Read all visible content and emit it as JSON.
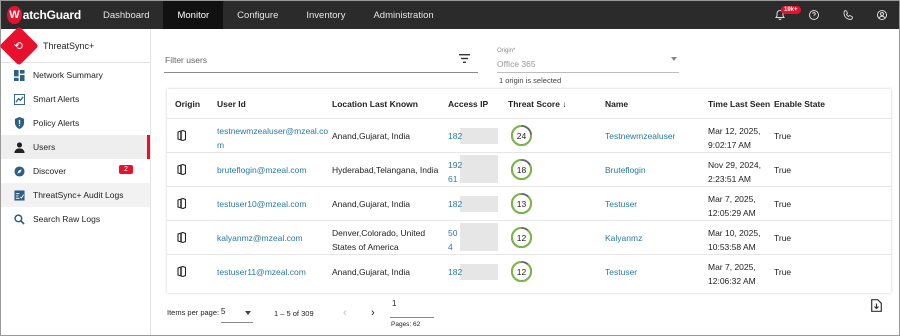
{
  "app": {
    "logo_mark": "W",
    "logo_text": "atchGuard"
  },
  "nav": [
    {
      "label": "Dashboard",
      "active": false
    },
    {
      "label": "Monitor",
      "active": true
    },
    {
      "label": "Configure",
      "active": false
    },
    {
      "label": "Inventory",
      "active": false
    },
    {
      "label": "Administration",
      "active": false
    }
  ],
  "topbar_right": {
    "notification_badge": "19k+",
    "icons": [
      "bell-icon",
      "help-icon",
      "phone-icon",
      "user-account-icon"
    ]
  },
  "sidebar": {
    "header": "ThreatSync+",
    "header_icon": "threatsync-icon",
    "items": [
      {
        "label": "Network Summary",
        "icon": "grid-icon"
      },
      {
        "label": "Smart Alerts",
        "icon": "smart-alerts-icon"
      },
      {
        "label": "Policy Alerts",
        "icon": "shield-alert-icon"
      },
      {
        "label": "Users",
        "icon": "person-icon",
        "active": true
      },
      {
        "label": "Discover",
        "icon": "compass-icon",
        "badge": "2"
      },
      {
        "label": "ThreatSync+ Audit Logs",
        "icon": "audit-logs-icon",
        "highlight": true
      },
      {
        "label": "Search Raw Logs",
        "icon": "search-icon"
      }
    ]
  },
  "filter": {
    "placeholder": "Filter users",
    "icon": "filter-icon"
  },
  "origin": {
    "label": "Origin*",
    "value": "Office 365",
    "note": "1 origin is selected"
  },
  "table": {
    "headers": {
      "origin": "Origin",
      "user_id": "User Id",
      "location": "Location Last Known",
      "ip": "Access IP",
      "score": "Threat Score",
      "sort_arrow": "↓",
      "name": "Name",
      "time": "Time Last Seen",
      "state": "Enable State"
    },
    "rows": [
      {
        "user_id_1": "testnewmzealuser@mzeal.co",
        "user_id_2": "m",
        "loc_1": "Anand,Gujarat, India",
        "loc_2": "",
        "ip_1": "182",
        "ip_2": "",
        "score": "24",
        "score_pct": 24,
        "score_color": "#7ab648",
        "name": "Testnewmzealuser",
        "time_1": "Mar 12, 2025,",
        "time_2": "9:02:17 AM",
        "state": "True"
      },
      {
        "user_id_1": "bruteflogin@mzeal.com",
        "user_id_2": "",
        "loc_1": "Hyderabad,Telangana, India",
        "loc_2": "",
        "ip_1": "192",
        "ip_2": "61",
        "score": "18",
        "score_pct": 18,
        "score_color": "#7ab648",
        "name": "Bruteflogin",
        "time_1": "Nov 29, 2024,",
        "time_2": "2:23:51 AM",
        "state": "True"
      },
      {
        "user_id_1": "testuser10@mzeal.com",
        "user_id_2": "",
        "loc_1": "Anand,Gujarat, India",
        "loc_2": "",
        "ip_1": "182",
        "ip_2": "",
        "score": "13",
        "score_pct": 13,
        "score_color": "#7ab648",
        "name": "Testuser",
        "time_1": "Mar 7, 2025,",
        "time_2": "12:05:29 AM",
        "state": "True"
      },
      {
        "user_id_1": "kalyanmz@mzeal.com",
        "user_id_2": "",
        "loc_1": "Denver,Colorado, United",
        "loc_2": "States of America",
        "ip_1": "50",
        "ip_2": "4",
        "score": "12",
        "score_pct": 12,
        "score_color": "#7ab648",
        "name": "Kalyanmz",
        "time_1": "Mar 10, 2025,",
        "time_2": "10:53:58 AM",
        "state": "True"
      },
      {
        "user_id_1": "testuser11@mzeal.com",
        "user_id_2": "",
        "loc_1": "Anand,Gujarat, India",
        "loc_2": "",
        "ip_1": "182",
        "ip_2": "",
        "score": "12",
        "score_pct": 12,
        "score_color": "#7ab648",
        "name": "Testuser",
        "time_1": "Mar 7, 2025,",
        "time_2": "12:06:32 AM",
        "state": "True"
      }
    ]
  },
  "pagination": {
    "items_label": "Items per page:",
    "per_page": "5",
    "range": "1 – 5 of 309",
    "prev": "‹",
    "next": "›",
    "current_page": "1",
    "total_pages": "Pages: 62"
  },
  "colors": {
    "accent": "#e8112d",
    "topbar": "#2b2b2b",
    "link": "#2a7aa0",
    "score_ring": "#7ab648"
  }
}
